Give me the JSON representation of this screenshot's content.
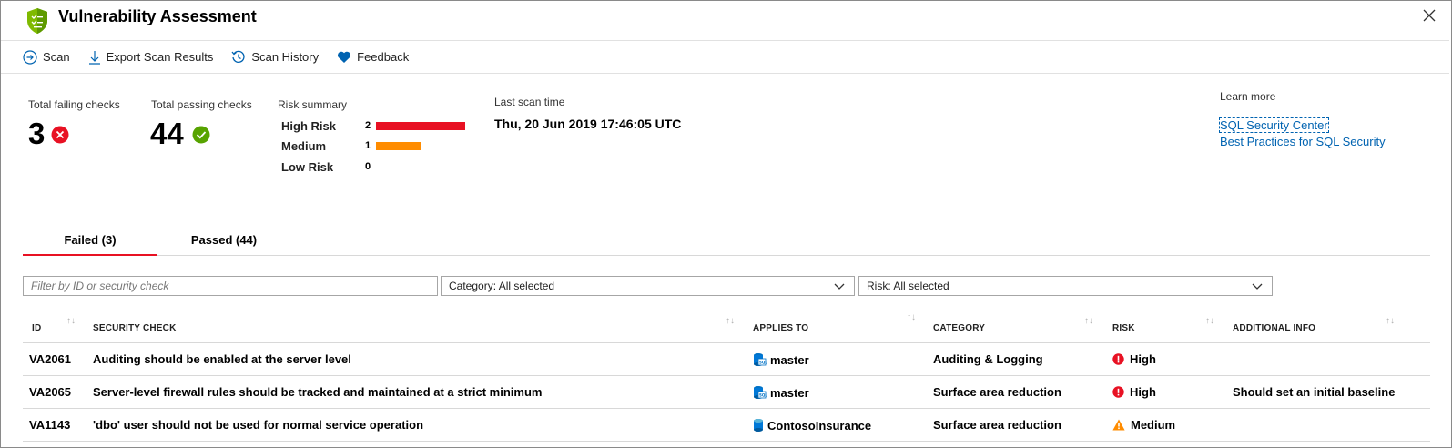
{
  "window": {
    "title": "Vulnerability Assessment"
  },
  "toolbar": {
    "scan": "Scan",
    "export": "Export Scan Results",
    "history": "Scan History",
    "feedback": "Feedback"
  },
  "summary": {
    "failing_label": "Total failing checks",
    "failing_value": "3",
    "passing_label": "Total passing checks",
    "passing_value": "44",
    "risk_label": "Risk summary",
    "risks": [
      {
        "name": "High Risk",
        "count": "2",
        "color": "#e81123"
      },
      {
        "name": "Medium",
        "count": "1",
        "color": "#ff8c00"
      },
      {
        "name": "Low Risk",
        "count": "0",
        "color": "#cccccc"
      }
    ],
    "last_scan_label": "Last scan time",
    "last_scan_value": "Thu, 20 Jun 2019 17:46:05 UTC",
    "learn_more_label": "Learn more",
    "links": [
      "SQL Security Center",
      "Best Practices for SQL Security"
    ]
  },
  "tabs": [
    {
      "label": "Failed (3)",
      "active": true
    },
    {
      "label": "Passed (44)",
      "active": false
    }
  ],
  "filters": {
    "search_placeholder": "Filter by ID or security check",
    "category": "Category: All selected",
    "risk": "Risk: All selected"
  },
  "table": {
    "headers": [
      "ID",
      "SECURITY CHECK",
      "APPLIES TO",
      "CATEGORY",
      "RISK",
      "ADDITIONAL INFO"
    ],
    "rows": [
      {
        "id": "VA2061",
        "check": "Auditing should be enabled at the server level",
        "applies_to": "master",
        "category": "Auditing & Logging",
        "risk": "High",
        "info": ""
      },
      {
        "id": "VA2065",
        "check": "Server-level firewall rules should be tracked and maintained at a strict minimum",
        "applies_to": "master",
        "category": "Surface area reduction",
        "risk": "High",
        "info": "Should set an initial baseline"
      },
      {
        "id": "VA1143",
        "check": "'dbo' user should not be used for normal service operation",
        "applies_to": "ContosoInsurance",
        "category": "Surface area reduction",
        "risk": "Medium",
        "info": ""
      }
    ]
  },
  "colors": {
    "accent": "#0063b1",
    "high": "#e81123",
    "medium": "#ff8c00",
    "pass": "#57a300",
    "shield": "#7fba00"
  }
}
